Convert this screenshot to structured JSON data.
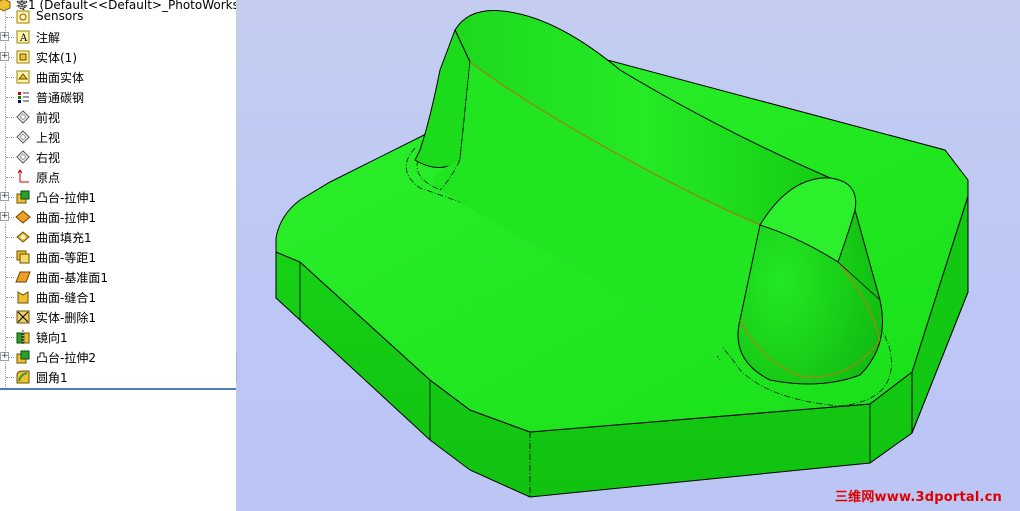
{
  "feature_tree": {
    "header_partial": "零1 (Default<<Default>_PhotoWorks",
    "items": [
      {
        "label": "Sensors",
        "icon": "sensor-icon",
        "expandable": false
      },
      {
        "label": "注解",
        "icon": "annotation-icon",
        "expandable": true
      },
      {
        "label": "实体(1)",
        "icon": "solid-bodies-icon",
        "expandable": true
      },
      {
        "label": "曲面实体",
        "icon": "surface-bodies-icon",
        "expandable": false
      },
      {
        "label": "普通碳钢",
        "icon": "material-icon",
        "expandable": false
      },
      {
        "label": "前视",
        "icon": "plane-icon",
        "expandable": false
      },
      {
        "label": "上视",
        "icon": "plane-icon",
        "expandable": false
      },
      {
        "label": "右视",
        "icon": "plane-icon",
        "expandable": false
      },
      {
        "label": "原点",
        "icon": "origin-icon",
        "expandable": false
      },
      {
        "label": "凸台-拉伸1",
        "icon": "boss-extrude-icon",
        "expandable": true
      },
      {
        "label": "曲面-拉伸1",
        "icon": "surface-extrude-icon",
        "expandable": true
      },
      {
        "label": "曲面填充1",
        "icon": "surface-fill-icon",
        "expandable": false
      },
      {
        "label": "曲面-等距1",
        "icon": "surface-offset-icon",
        "expandable": false
      },
      {
        "label": "曲面-基准面1",
        "icon": "planar-surface-icon",
        "expandable": false
      },
      {
        "label": "曲面-缝合1",
        "icon": "surface-knit-icon",
        "expandable": false
      },
      {
        "label": "实体-删除1",
        "icon": "delete-body-icon",
        "expandable": false
      },
      {
        "label": "镜向1",
        "icon": "mirror-icon",
        "expandable": false
      },
      {
        "label": "凸台-拉伸2",
        "icon": "boss-extrude-icon",
        "expandable": true
      },
      {
        "label": "圆角1",
        "icon": "fillet-icon",
        "expandable": false
      }
    ]
  },
  "viewport": {
    "background_color": "#bdc7f6",
    "model_color": "#1fe61f",
    "edge_color": "#000000",
    "highlight_edge_color": "#c07a10"
  },
  "watermark": "三维网www.3dportal.cn"
}
